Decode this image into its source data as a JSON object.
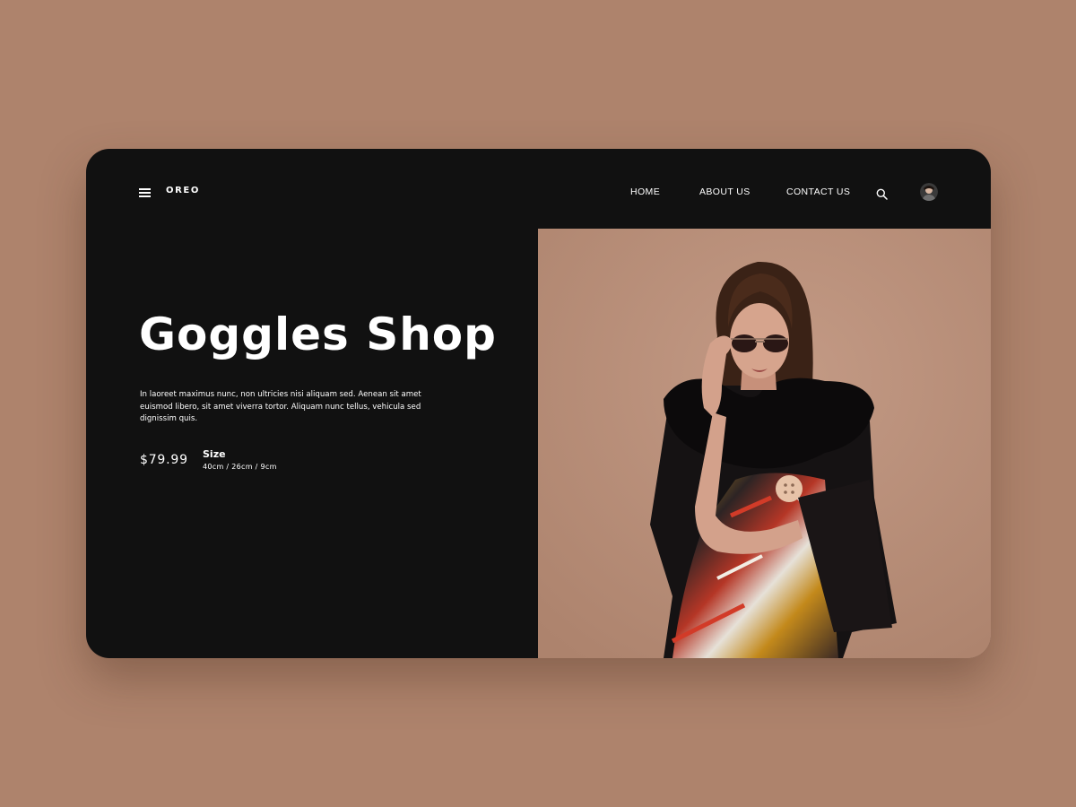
{
  "colors": {
    "page_background": "#ae836c",
    "card_background": "#111111",
    "text": "#ffffff",
    "photo_background": "#b98e78"
  },
  "header": {
    "menu_icon": "hamburger-menu-icon",
    "logo": "OREO",
    "nav": [
      {
        "label": "HOME"
      },
      {
        "label": "ABOUT US"
      },
      {
        "label": "CONTACT US"
      }
    ],
    "search_icon": "search-icon",
    "avatar_icon": "user-avatar"
  },
  "hero": {
    "title": "Goggles Shop",
    "description": "In laoreet maximus nunc, non ultricies nisi aliquam sed. Aenean sit amet euismod libero, sit amet viverra tortor. Aliquam nunc tellus, vehicula sed dignissim quis.",
    "price": "$79.99",
    "size_label": "Size",
    "size_value": "40cm / 26cm / 9cm",
    "image_icon": "model-wearing-sunglasses-photo"
  }
}
